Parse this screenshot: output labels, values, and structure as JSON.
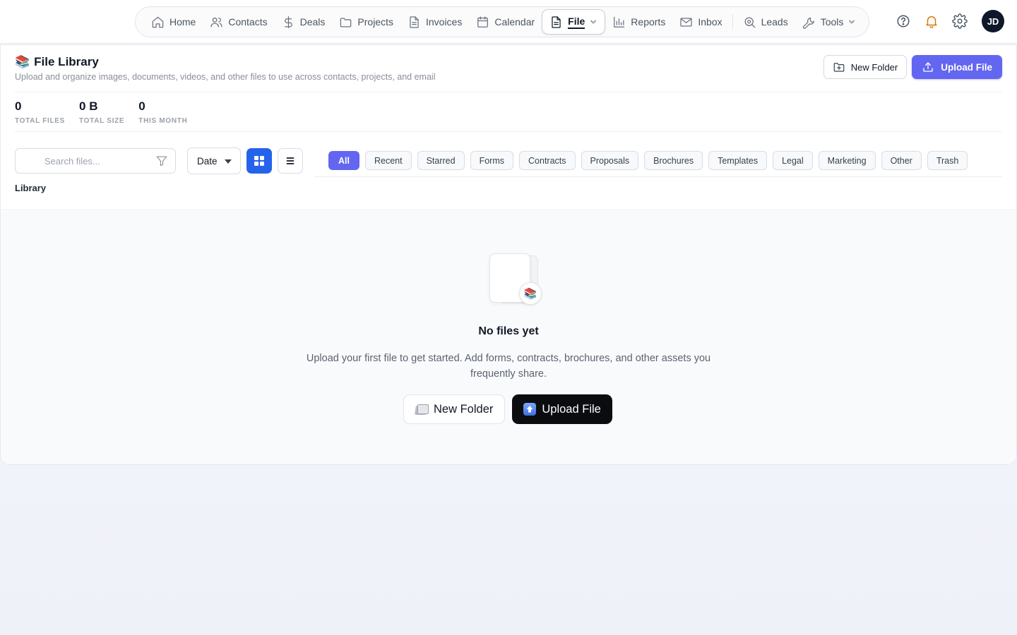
{
  "nav": {
    "items": [
      {
        "key": "home",
        "label": "Home",
        "icon": "home-icon"
      },
      {
        "key": "contacts",
        "label": "Contacts",
        "icon": "users-icon"
      },
      {
        "key": "deals",
        "label": "Deals",
        "icon": "dollar-icon"
      },
      {
        "key": "projects",
        "label": "Projects",
        "icon": "folder-icon"
      },
      {
        "key": "invoices",
        "label": "Invoices",
        "icon": "document-icon"
      },
      {
        "key": "calendar",
        "label": "Calendar",
        "icon": "calendar-icon"
      },
      {
        "key": "file",
        "label": "File",
        "icon": "file-icon",
        "active": true,
        "dropdown": true
      },
      {
        "key": "reports",
        "label": "Reports",
        "icon": "bar-chart-icon"
      },
      {
        "key": "inbox",
        "label": "Inbox",
        "icon": "mail-icon"
      },
      {
        "key": "leads",
        "label": "Leads",
        "icon": "search-icon"
      },
      {
        "key": "tools",
        "label": "Tools",
        "icon": "wrench-icon",
        "dropdown": true
      }
    ],
    "user_initials": "JD"
  },
  "header": {
    "emoji": "📚",
    "title": "File Library",
    "subtitle": "Upload and organize images, documents, videos, and other files to use across contacts, projects, and email",
    "new_folder_label": "New Folder",
    "upload_label": "Upload File"
  },
  "stats": [
    {
      "value": "0",
      "label": "TOTAL FILES"
    },
    {
      "value": "0 B",
      "label": "TOTAL SIZE"
    },
    {
      "value": "0",
      "label": "THIS MONTH"
    }
  ],
  "toolbar": {
    "search_placeholder": "Search files...",
    "sort_value": "Date",
    "view_mode": "grid"
  },
  "filters": [
    {
      "label": "All",
      "active": true
    },
    {
      "label": "Recent"
    },
    {
      "label": "Starred"
    },
    {
      "label": "Forms"
    },
    {
      "label": "Contracts"
    },
    {
      "label": "Proposals"
    },
    {
      "label": "Brochures"
    },
    {
      "label": "Templates"
    },
    {
      "label": "Legal"
    },
    {
      "label": "Marketing"
    },
    {
      "label": "Other"
    },
    {
      "label": "Trash"
    }
  ],
  "breadcrumb": "Library",
  "empty_state": {
    "emoji": "📚",
    "title": "No files yet",
    "description": "Upload your first file to get started. Add forms, contracts, brochures, and other assets you frequently share.",
    "new_folder_label": "New Folder",
    "upload_label": "Upload File"
  },
  "colors": {
    "accent": "#6366f1",
    "view_toggle_active": "#2563eb",
    "dark_button": "#0b0c10",
    "notification_bell": "#d97706"
  }
}
